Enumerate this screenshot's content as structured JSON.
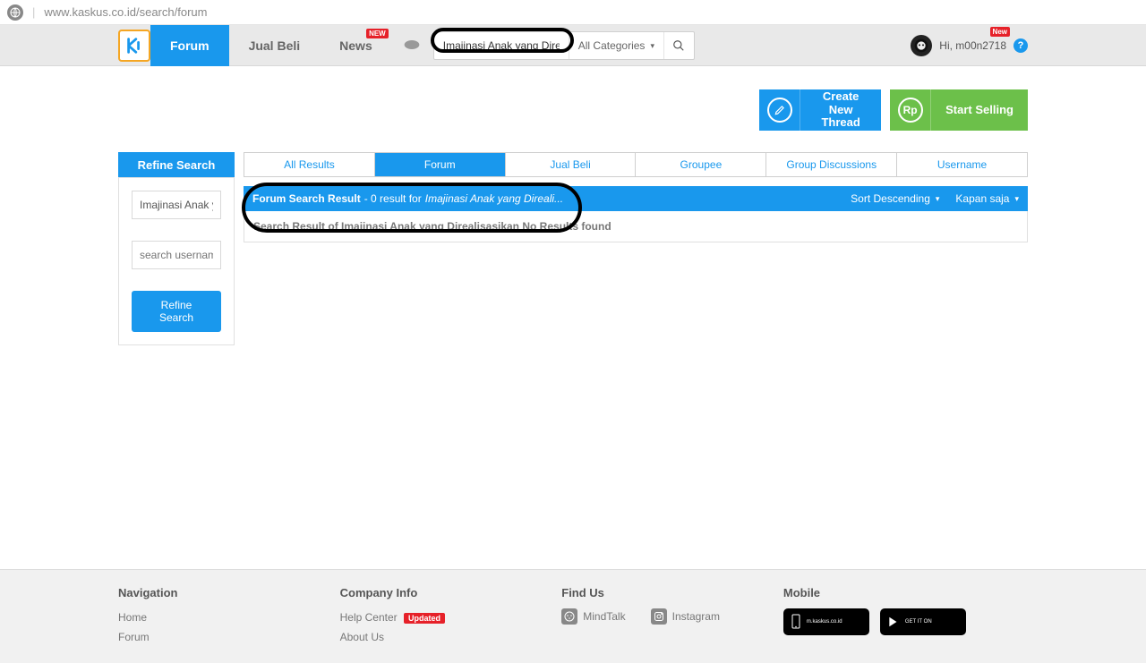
{
  "browser": {
    "url": "www.kaskus.co.id/search/forum"
  },
  "nav": {
    "forum": "Forum",
    "jualbeli": "Jual Beli",
    "news": "News",
    "new_badge": "NEW"
  },
  "search": {
    "value": "Imajinasi Anak yang Direalis",
    "category": "All Categories"
  },
  "user": {
    "greeting": "Hi, m00n2718",
    "new_badge": "New"
  },
  "actions": {
    "create_thread": "Create New Thread",
    "start_selling": "Start Selling",
    "rp": "Rp"
  },
  "refine": {
    "header": "Refine Search",
    "query_value": "Imajinasi Anak yan",
    "username_placeholder": "search username",
    "button": "Refine Search"
  },
  "tabs": {
    "all": "All Results",
    "forum": "Forum",
    "jualbeli": "Jual Beli",
    "groupee": "Groupee",
    "group_disc": "Group Discussions",
    "username": "Username"
  },
  "result": {
    "title": "Forum Search Result",
    "summary": " - 0 result for ",
    "query": "Imajinasi Anak yang Direali...",
    "sort": "Sort Descending",
    "when": "Kapan saja",
    "body": "Search Result of Imajinasi Anak yang Direalisasikan No Results found"
  },
  "footer": {
    "nav_h": "Navigation",
    "nav_home": "Home",
    "nav_forum": "Forum",
    "co_h": "Company Info",
    "co_help": "Help Center",
    "co_updated": "Updated",
    "co_about": "About Us",
    "find_h": "Find Us",
    "find_mind": "MindTalk",
    "find_ig": "Instagram",
    "mob_h": "Mobile",
    "store1_t1": "m.kaskus.co.id",
    "store2_t1": "GET IT ON"
  }
}
